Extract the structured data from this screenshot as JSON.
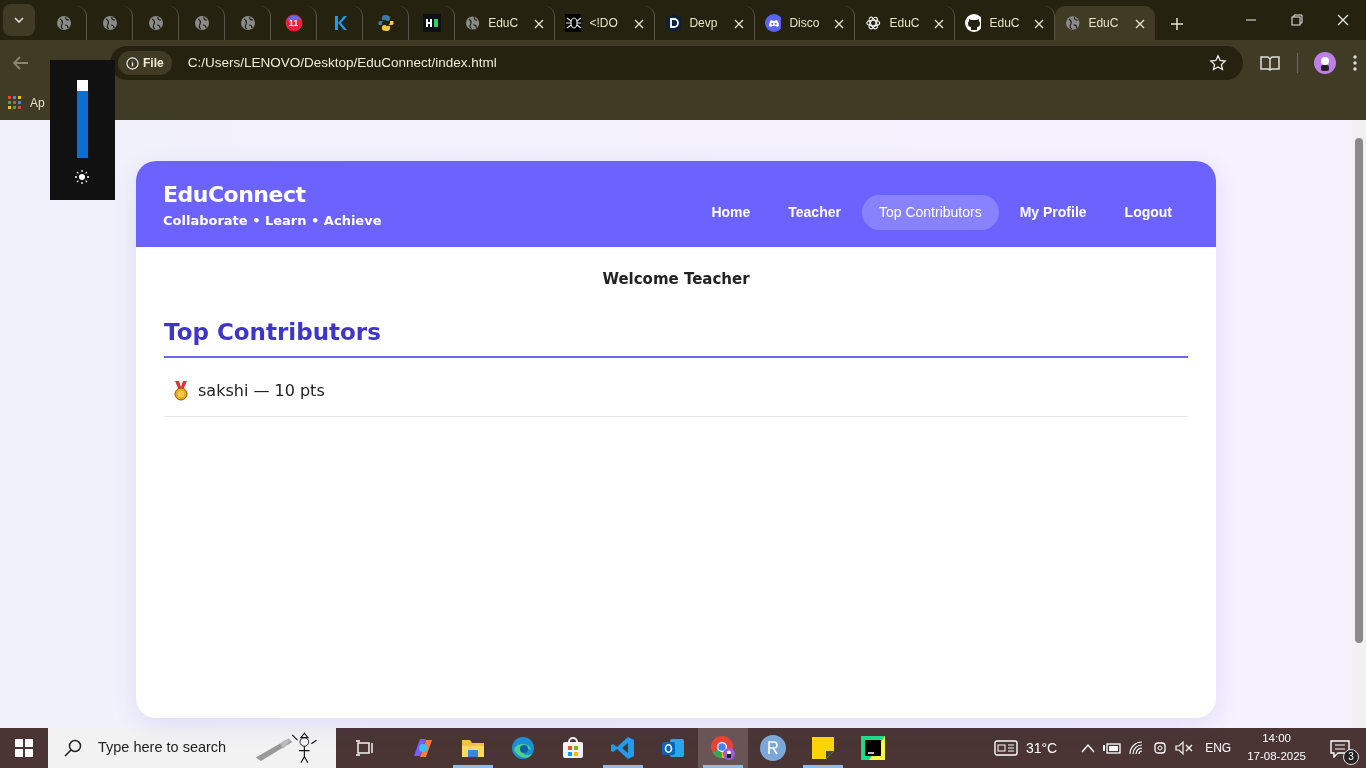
{
  "browser": {
    "tabs": [
      {
        "kind": "globe",
        "selected": false
      },
      {
        "kind": "globe",
        "selected": false
      },
      {
        "kind": "globe",
        "selected": false
      },
      {
        "kind": "globe",
        "selected": false
      },
      {
        "kind": "globe",
        "selected": false
      },
      {
        "kind": "calendar",
        "badge": "11",
        "selected": false
      },
      {
        "kind": "k",
        "selected": false
      },
      {
        "kind": "python",
        "selected": false
      },
      {
        "kind": "square",
        "selected": false
      },
      {
        "kind": "globe",
        "title": "EduC",
        "selected": false
      },
      {
        "kind": "bug",
        "title": "<!DO",
        "selected": false
      },
      {
        "kind": "d",
        "selected": false,
        "title": "Devp"
      },
      {
        "kind": "discord",
        "title": "Disco",
        "selected": false
      },
      {
        "kind": "knot",
        "title": "EduC",
        "selected": false
      },
      {
        "kind": "github",
        "title": "EduC",
        "selected": false
      },
      {
        "kind": "globe",
        "title": "EduC",
        "selected": true
      }
    ],
    "scheme": "File",
    "address": "C:/Users/LENOVO/Desktop/EduConnect/index.html",
    "bookmark": "Ap",
    "brightness": {
      "level": 0.86
    }
  },
  "app": {
    "brand": "EduConnect",
    "tagline": "Collaborate • Learn • Achieve",
    "nav": [
      {
        "label": "Home",
        "selected": false
      },
      {
        "label": "Teacher",
        "selected": false
      },
      {
        "label": "Top Contributors",
        "selected": true
      },
      {
        "label": "My Profile",
        "selected": false
      },
      {
        "label": "Logout",
        "selected": false
      }
    ],
    "welcome": "Welcome Teacher",
    "heading": "Top Contributors",
    "contributors": [
      {
        "text": "sakshi — 10 pts"
      }
    ]
  },
  "taskbar": {
    "search_placeholder": "Type here to search",
    "apps": [
      {
        "kind": "copilot",
        "open": false
      },
      {
        "kind": "folder",
        "open": true
      },
      {
        "kind": "edge",
        "open": false
      },
      {
        "kind": "store",
        "open": false
      },
      {
        "kind": "vscode",
        "open": true
      },
      {
        "kind": "outlook",
        "open": false
      },
      {
        "kind": "chrome",
        "open": true
      },
      {
        "kind": "r",
        "open": false
      },
      {
        "kind": "notes",
        "open": true
      },
      {
        "kind": "pycharm",
        "open": false
      }
    ],
    "weather": "31°C",
    "language": "ENG",
    "time": "14:00",
    "date": "17-08-2025",
    "notifications": "3"
  }
}
